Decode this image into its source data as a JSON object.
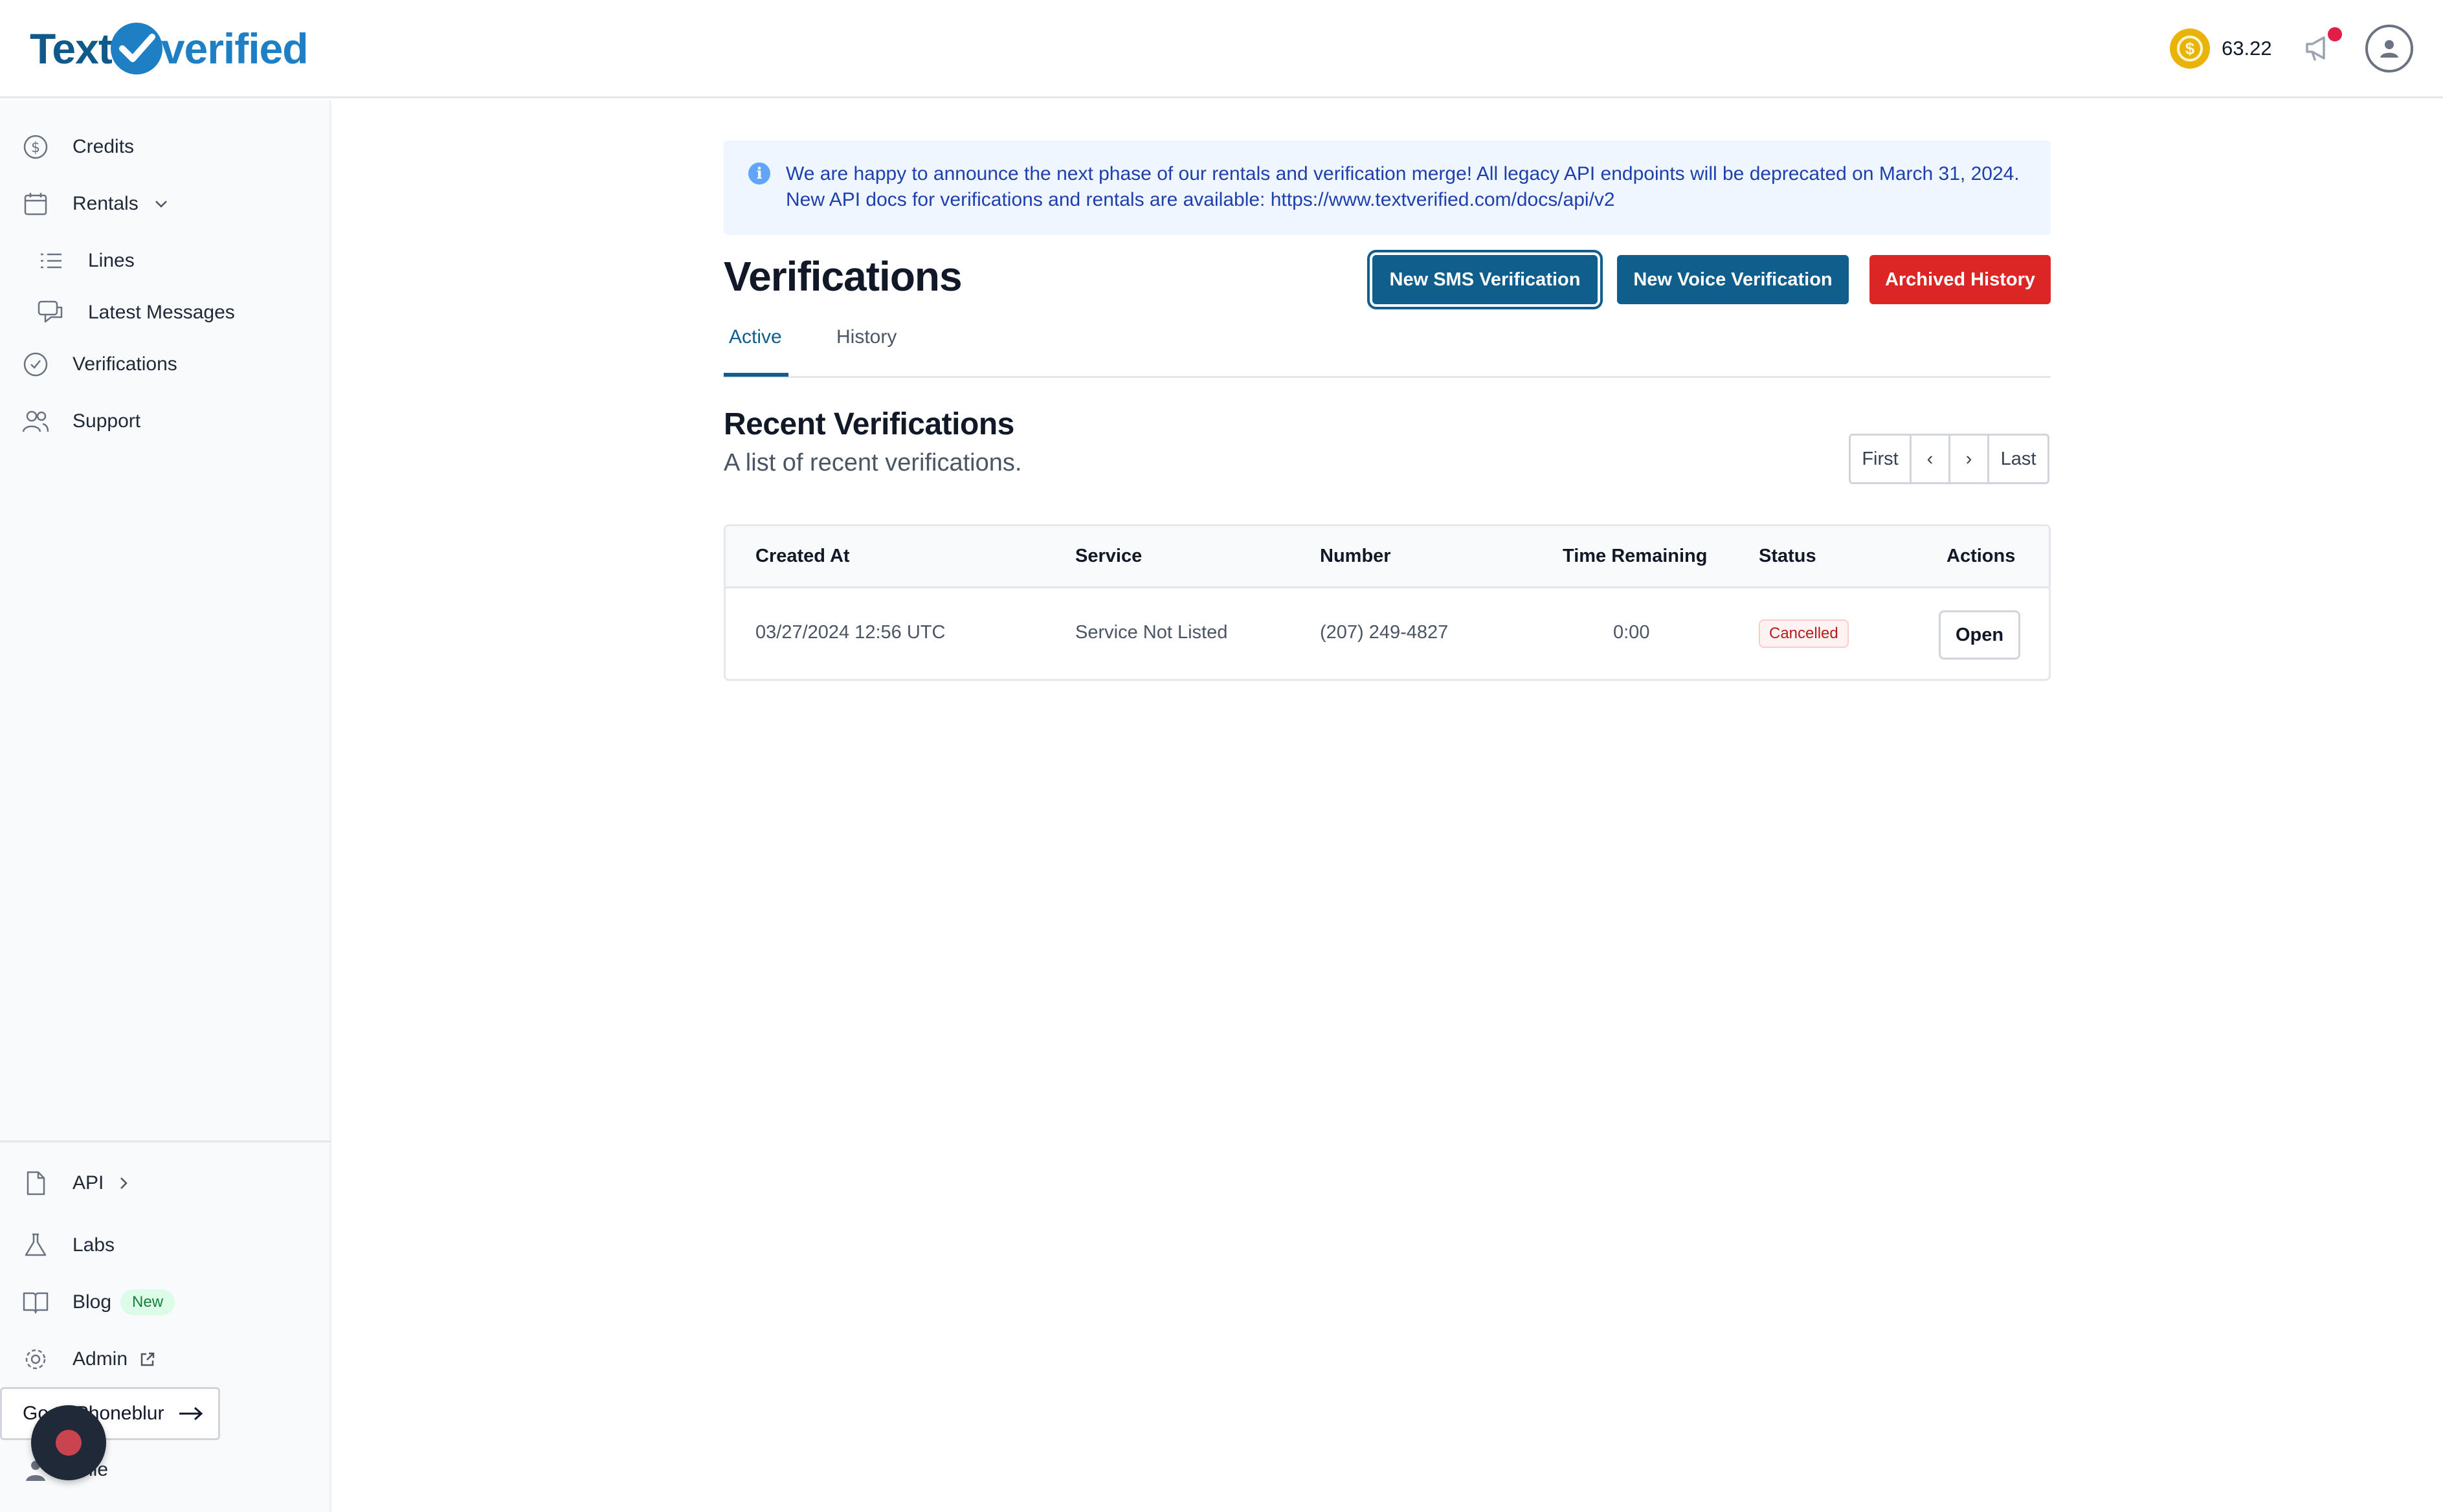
{
  "header": {
    "logo_left": "Text",
    "logo_right": "verified",
    "credit_symbol": "$",
    "credits": "63.22"
  },
  "sidebar": {
    "items": [
      {
        "label": "Credits",
        "icon": "dollar-circle-icon"
      },
      {
        "label": "Rentals",
        "icon": "calendar-icon"
      },
      {
        "label": "Lines",
        "icon": "list-icon"
      },
      {
        "label": "Latest Messages",
        "icon": "chat-icon"
      },
      {
        "label": "Verifications",
        "icon": "check-circle-icon"
      },
      {
        "label": "Support",
        "icon": "users-icon"
      }
    ],
    "bottom_items": [
      {
        "label": "API",
        "icon": "document-icon"
      },
      {
        "label": "Labs",
        "icon": "flask-icon"
      },
      {
        "label": "Blog",
        "icon": "book-icon",
        "badge": "New"
      },
      {
        "label": "Admin",
        "icon": "gear-icon"
      },
      {
        "label": "ofile",
        "icon": "user-icon"
      }
    ],
    "phoneblur_label": "Go to Phoneblur"
  },
  "announcement": {
    "line1": "We are happy to announce the next phase of our rentals and verification merge! All legacy API endpoints will be deprecated on March 31, 2024.",
    "line2": "New API docs for verifications and rentals are available: https://www.textverified.com/docs/api/v2"
  },
  "main": {
    "title": "Verifications",
    "buttons": {
      "sms": "New SMS Verification",
      "voice": "New Voice Verification",
      "archived": "Archived History"
    },
    "tabs": [
      "Active",
      "History"
    ],
    "section_title": "Recent Verifications",
    "section_subtitle": "A list of recent verifications.",
    "pager": [
      "First",
      "‹",
      "›",
      "Last"
    ]
  },
  "table": {
    "columns": [
      "Created At",
      "Service",
      "Number",
      "Time Remaining",
      "Status",
      "Actions"
    ],
    "rows": [
      {
        "created_at": "03/27/2024 12:56 UTC",
        "service": "Service Not Listed",
        "number": "(207) 249-4827",
        "time_remaining": "0:00",
        "status": "Cancelled",
        "action": "Open"
      }
    ]
  },
  "colors": {
    "brand": "#0f5e8c",
    "danger": "#dc2626",
    "coin": "#eab308"
  }
}
